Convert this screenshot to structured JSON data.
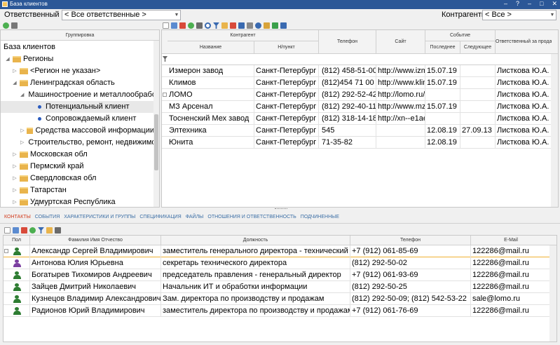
{
  "window": {
    "title": "База клиентов",
    "controls": [
      "–",
      "?",
      "–",
      "□",
      "✕"
    ]
  },
  "filters": {
    "responsible_label": "Ответственный",
    "responsible_value": "< Все ответственные >",
    "contractors_label": "Контрагенты",
    "contractors_value": "< Все >"
  },
  "left": {
    "header": "Группировка",
    "tree": [
      {
        "label": "База клиентов",
        "level": 0,
        "type": "root"
      },
      {
        "label": "Регионы",
        "level": 1,
        "type": "folder",
        "expanded": true
      },
      {
        "label": "<Регион не указан>",
        "level": 2,
        "type": "folder"
      },
      {
        "label": "Ленинградская область",
        "level": 2,
        "type": "folder",
        "expanded": true
      },
      {
        "label": "Машиностроение и металлообработка",
        "level": 3,
        "type": "folder",
        "expanded": true
      },
      {
        "label": "Потенциальный клиент",
        "level": 4,
        "type": "dot",
        "selected": true
      },
      {
        "label": "Сопровождаемый клиент",
        "level": 4,
        "type": "dot"
      },
      {
        "label": "Средства массовой информации",
        "level": 3,
        "type": "folder"
      },
      {
        "label": "Строительство, ремонт, недвижимость",
        "level": 3,
        "type": "folder"
      },
      {
        "label": "Московская обл",
        "level": 2,
        "type": "folder"
      },
      {
        "label": "Пермский край",
        "level": 2,
        "type": "folder"
      },
      {
        "label": "Свердловская обл",
        "level": 2,
        "type": "folder"
      },
      {
        "label": "Татарстан",
        "level": 2,
        "type": "folder"
      },
      {
        "label": "Удмуртская Республика",
        "level": 2,
        "type": "folder"
      }
    ]
  },
  "grid": {
    "group_headers": {
      "contractor": "Контрагент",
      "event": "Событие"
    },
    "columns": {
      "name": "Название",
      "city": "Н/пункт",
      "phone": "Телефон",
      "site": "Сайт",
      "last": "Последнее",
      "next": "Следующее",
      "responsible": "Ответственный за продажи"
    },
    "rows": [
      {
        "name": "Измерон завод",
        "city": "Санкт-Петербург",
        "phone": "(812) 458-51-00",
        "site": "http://www.izm",
        "last": "15.07.19",
        "next": "",
        "resp": "Листкова Ю.А."
      },
      {
        "name": "Климов",
        "city": "Санкт-Петербург",
        "phone": "(812)454 71 00",
        "site": "http://www.klim",
        "last": "15.07.19",
        "next": "",
        "resp": "Листкова Ю.А."
      },
      {
        "name": "ЛОМО",
        "city": "Санкт-Петербург",
        "phone": "(812) 292-52-42",
        "site": "http://lomo.ru/",
        "last": "",
        "next": "",
        "resp": "Листкова Ю.А."
      },
      {
        "name": "МЗ Арсенал",
        "city": "Санкт-Петербург",
        "phone": "(812) 292-40-11, (",
        "site": "http://www.mz",
        "last": "15.07.19",
        "next": "",
        "resp": "Листкова Ю.А."
      },
      {
        "name": "Тосненский Мех завод",
        "city": "Санкт-Петербург",
        "phone": "(812) 318-14-18, (",
        "site": "http://xn--e1ae",
        "last": "",
        "next": "",
        "resp": "Листкова Ю.А."
      },
      {
        "name": "Элтехника",
        "city": "Санкт-Петербург",
        "phone": "545",
        "site": "",
        "last": "12.08.19",
        "next": "27.09.13",
        "resp": "Листкова Ю.А."
      },
      {
        "name": "Юнита",
        "city": "Санкт-Петербург",
        "phone": "71-35-82",
        "site": "",
        "last": "12.08.19",
        "next": "",
        "resp": "Листкова Ю.А."
      }
    ]
  },
  "tabs": [
    "КОНТАКТЫ",
    "СОБЫТИЯ",
    "ХАРАКТЕРИСТИКИ И ГРУППЫ",
    "СПЕЦИФИКАЦИЯ",
    "ФАЙЛЫ",
    "ОТНОШЕНИЯ И ОТВЕТСТВЕННОСТЬ",
    "ПОДЧИНЕННЫЕ"
  ],
  "contacts": {
    "columns": {
      "pol": "Пол",
      "fio": "Фамилия Имя Отчество",
      "pos": "Должность",
      "phone": "Телефон",
      "email": "E-Mail"
    },
    "rows": [
      {
        "gender": "m",
        "fio": "Александр Сергей Владимирович",
        "pos": "заместитель генерального директора - технический директо",
        "phone": "+7 (912) 061-85-69",
        "email": "122286@mail.ru"
      },
      {
        "gender": "f",
        "fio": "Антонова Юлия Юрьевна",
        "pos": "секретарь технического директора",
        "phone": "(812) 292-50-02",
        "email": "122286@mail.ru"
      },
      {
        "gender": "m",
        "fio": "Богатырев Тихомиров Андреевич",
        "pos": "председатель правления - генеральный директор",
        "phone": "+7 (912) 061-93-69",
        "email": "122286@mail.ru"
      },
      {
        "gender": "m",
        "fio": "Зайцев Дмитрий Николаевич",
        "pos": "Начальник ИТ и обработки информации",
        "phone": "(812) 292-50-25",
        "email": "122286@mail.ru"
      },
      {
        "gender": "m",
        "fio": "Кузнецов Владимир Александрович",
        "pos": "Зам. директора по производству и продажам",
        "phone": "(812) 292-50-09; (812) 542-53-22",
        "email": "sale@lomo.ru"
      },
      {
        "gender": "m",
        "fio": "Радионов Юрий Владимирович",
        "pos": "заместитель директора по производству и продажам - начал",
        "phone": "+7 (912) 061-76-69",
        "email": "122286@mail.ru"
      }
    ]
  },
  "colors": {
    "titlebar": "#2b5797",
    "tab_active": "#d23a1b",
    "tab": "#3b6ea5",
    "folder": "#e9b44c",
    "dot": "#2a5bbf",
    "male": "#2e7d32",
    "female": "#7b3fa0"
  }
}
